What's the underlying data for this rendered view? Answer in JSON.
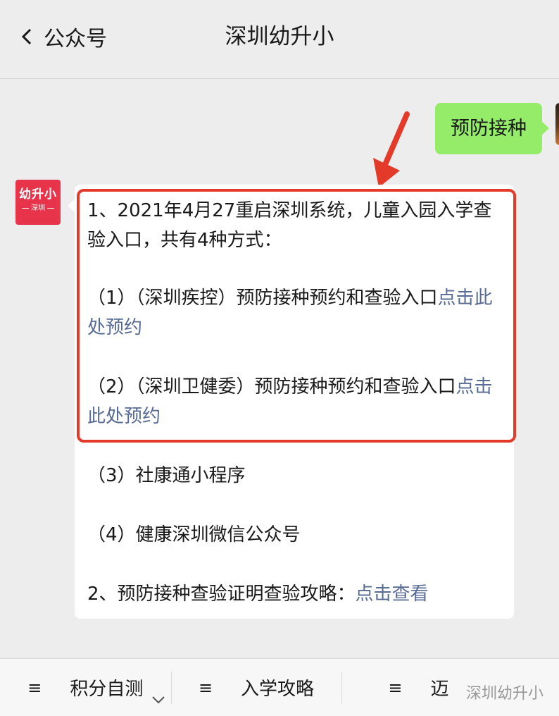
{
  "header": {
    "back_label": "公众号",
    "title": "深圳幼升小"
  },
  "outgoing": {
    "text": "预防接种"
  },
  "account": {
    "brand": "幼升小",
    "sub": "深圳"
  },
  "message": {
    "p1": "1、2021年4月27重启深圳系统，儿童入园入学查验入口，共有4种方式：",
    "p2_text": "（1）（深圳疾控）预防接种预约和查验入口",
    "p2_link": "点击此处预约",
    "p3_text": "（2）（深圳卫健委）预防接种预约和查验入口",
    "p3_link": "点击此处预约",
    "p4": "（3）社康通小程序",
    "p5": "（4）健康深圳微信公众号",
    "p6_text": "2、预防接种查验证明查验攻略：",
    "p6_link": "点击查看"
  },
  "menu": {
    "items": [
      "积分自测",
      "入学攻略",
      "迈"
    ]
  },
  "watermark": "深圳幼升小",
  "colors": {
    "link": "#576b95",
    "bubble": "#95ec69",
    "highlight": "#e33a2a",
    "avatar": "#e8344a"
  }
}
